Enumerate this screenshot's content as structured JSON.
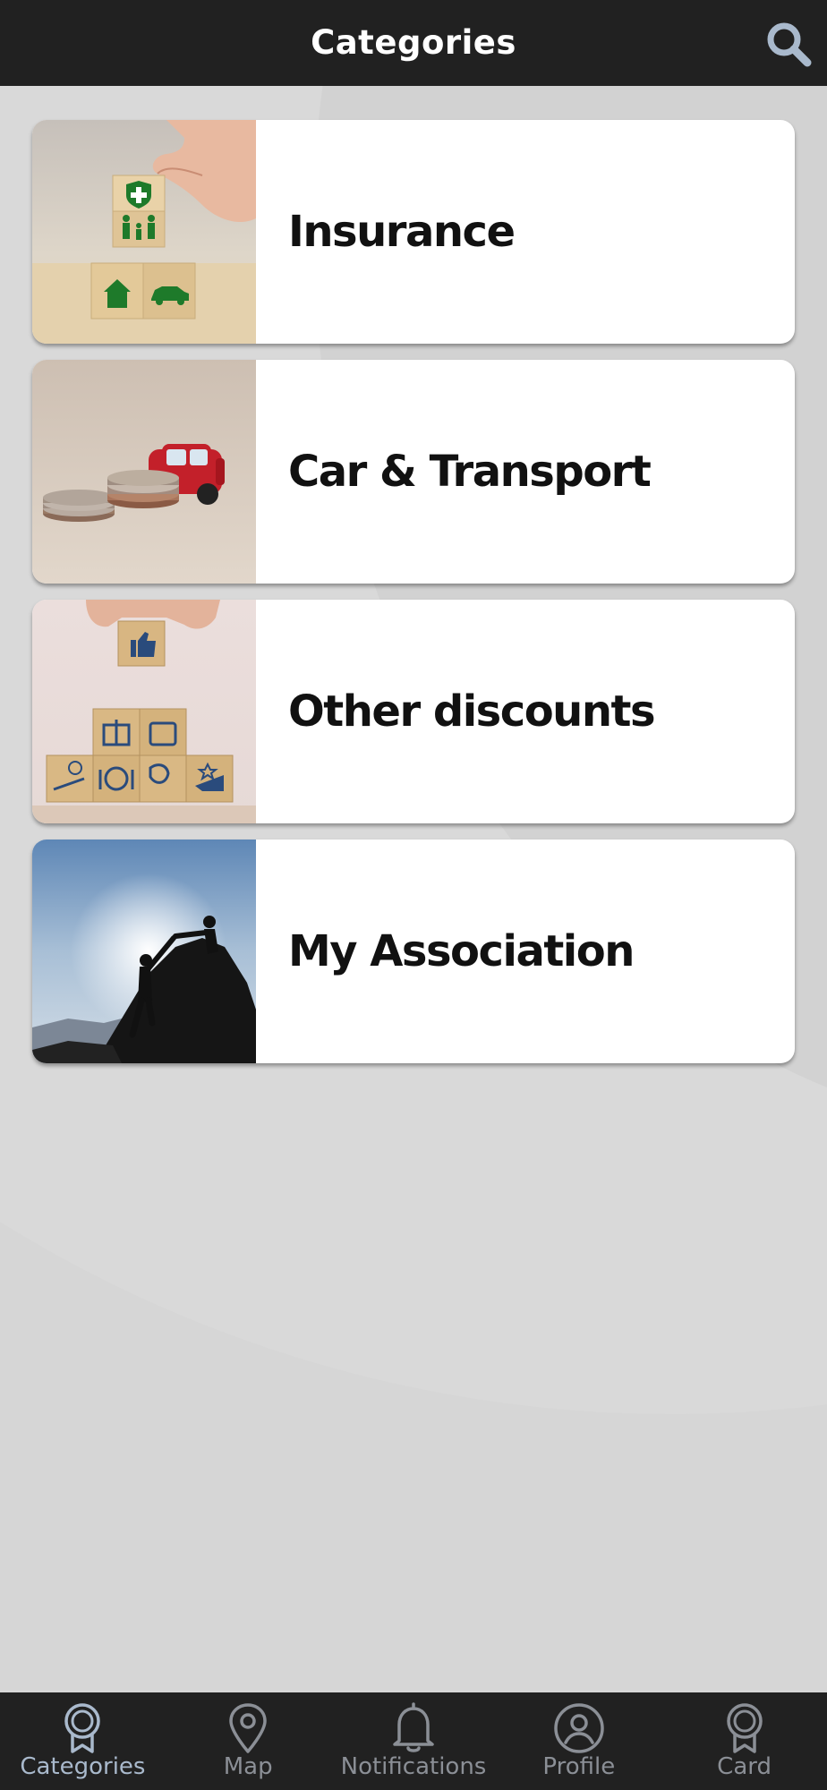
{
  "header": {
    "title": "Categories",
    "search_icon": "search-icon"
  },
  "categories": [
    {
      "label": "Insurance",
      "image": "insurance-blocks-image"
    },
    {
      "label": "Car & Transport",
      "image": "toy-car-coins-image"
    },
    {
      "label": "Other discounts",
      "image": "discount-blocks-image"
    },
    {
      "label": "My Association",
      "image": "climbers-helping-image"
    }
  ],
  "bottom_nav": {
    "active": "Categories",
    "items": [
      {
        "label": "Categories",
        "icon": "award-ribbon-icon"
      },
      {
        "label": "Map",
        "icon": "map-pin-icon"
      },
      {
        "label": "Notifications",
        "icon": "bell-icon"
      },
      {
        "label": "Profile",
        "icon": "user-circle-icon"
      },
      {
        "label": "Card",
        "icon": "award-ribbon-icon"
      }
    ]
  },
  "colors": {
    "header_bg": "#212121",
    "page_bg": "#d6d6d6",
    "accent": "#a9b9cc",
    "nav_inactive": "#8b8f96"
  }
}
